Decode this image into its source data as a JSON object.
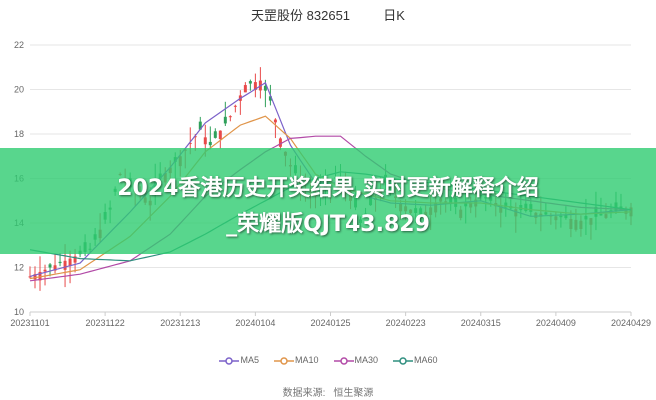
{
  "header": {
    "stock_name": "天罡股份",
    "stock_code": "832651",
    "period": "日K"
  },
  "banner": {
    "line1": "2024香港历史开奖结果,实时更新解释介绍",
    "line2": "_荣耀版QJT43.829"
  },
  "legend": [
    {
      "name": "MA5",
      "color": "#7b61c9"
    },
    {
      "name": "MA10",
      "color": "#e0954a"
    },
    {
      "name": "MA30",
      "color": "#b24aa7"
    },
    {
      "name": "MA60",
      "color": "#2f8f7f"
    }
  ],
  "source": {
    "label": "数据来源:",
    "value": "恒生聚源"
  },
  "colors": {
    "up": "#e84a4a",
    "down": "#2fa05a",
    "grid": "#e6e6e6",
    "axis_text": "#666666"
  },
  "chart_data": {
    "type": "candlestick",
    "y_ticks": [
      "10",
      "12",
      "14",
      "16",
      "18",
      "20",
      "22"
    ],
    "ylim": [
      10,
      22
    ],
    "x_ticks": [
      "20231101",
      "20231122",
      "20231213",
      "20240104",
      "20240125",
      "20240223",
      "20240315",
      "20240409",
      "20240429"
    ],
    "x_tick_positions": [
      0,
      15,
      30,
      45,
      60,
      75,
      90,
      105,
      120
    ],
    "x_count": 121,
    "ma_anchor": {
      "MA5": [
        [
          0,
          11.6
        ],
        [
          10,
          12.2
        ],
        [
          20,
          14.5
        ],
        [
          28,
          16.5
        ],
        [
          35,
          18.5
        ],
        [
          42,
          19.6
        ],
        [
          47,
          20.3
        ],
        [
          52,
          17.5
        ],
        [
          57,
          15.8
        ],
        [
          62,
          15.8
        ],
        [
          67,
          15.2
        ],
        [
          72,
          14.9
        ],
        [
          80,
          14.8
        ],
        [
          90,
          15.0
        ],
        [
          100,
          14.3
        ],
        [
          110,
          14.4
        ],
        [
          120,
          14.6
        ]
      ],
      "MA10": [
        [
          0,
          11.5
        ],
        [
          10,
          11.9
        ],
        [
          20,
          13.4
        ],
        [
          28,
          15.2
        ],
        [
          35,
          17.2
        ],
        [
          42,
          18.4
        ],
        [
          47,
          18.8
        ],
        [
          52,
          17.8
        ],
        [
          57,
          16.2
        ],
        [
          62,
          15.6
        ],
        [
          67,
          15.3
        ],
        [
          72,
          15.0
        ],
        [
          80,
          14.9
        ],
        [
          90,
          14.9
        ],
        [
          100,
          14.6
        ],
        [
          110,
          14.4
        ],
        [
          120,
          14.5
        ]
      ],
      "MA30": [
        [
          0,
          11.4
        ],
        [
          10,
          11.7
        ],
        [
          20,
          12.3
        ],
        [
          28,
          13.5
        ],
        [
          35,
          15.2
        ],
        [
          42,
          16.4
        ],
        [
          47,
          17.2
        ],
        [
          52,
          17.8
        ],
        [
          57,
          17.9
        ],
        [
          62,
          17.9
        ],
        [
          67,
          17.0
        ],
        [
          72,
          16.2
        ],
        [
          80,
          15.6
        ],
        [
          90,
          15.3
        ],
        [
          100,
          15.0
        ],
        [
          110,
          14.7
        ],
        [
          120,
          14.6
        ]
      ],
      "MA60": [
        [
          0,
          12.8
        ],
        [
          10,
          12.4
        ],
        [
          20,
          12.3
        ],
        [
          28,
          12.7
        ],
        [
          35,
          13.5
        ],
        [
          42,
          14.4
        ],
        [
          47,
          15.0
        ],
        [
          52,
          15.6
        ],
        [
          57,
          16.0
        ],
        [
          62,
          16.3
        ],
        [
          67,
          16.2
        ],
        [
          72,
          16.0
        ],
        [
          80,
          15.8
        ],
        [
          90,
          15.5
        ],
        [
          100,
          15.2
        ],
        [
          110,
          14.9
        ],
        [
          120,
          14.6
        ]
      ]
    },
    "close_anchor": [
      [
        0,
        11.6
      ],
      [
        8,
        12.4
      ],
      [
        12,
        12.8
      ],
      [
        16,
        14.6
      ],
      [
        18,
        16.2
      ],
      [
        20,
        15.6
      ],
      [
        24,
        15.0
      ],
      [
        26,
        16.0
      ],
      [
        30,
        17.0
      ],
      [
        34,
        18.2
      ],
      [
        36,
        17.5
      ],
      [
        40,
        18.8
      ],
      [
        43,
        20.2
      ],
      [
        46,
        20.4
      ],
      [
        48,
        19.5
      ],
      [
        50,
        17.8
      ],
      [
        52,
        16.6
      ],
      [
        55,
        15.5
      ],
      [
        58,
        15.2
      ],
      [
        61,
        16.0
      ],
      [
        64,
        15.4
      ],
      [
        66,
        14.0
      ],
      [
        68,
        14.8
      ],
      [
        71,
        15.8
      ],
      [
        74,
        14.9
      ],
      [
        78,
        14.3
      ],
      [
        82,
        15.1
      ],
      [
        86,
        14.6
      ],
      [
        90,
        15.2
      ],
      [
        95,
        14.7
      ],
      [
        100,
        14.5
      ],
      [
        105,
        14.3
      ],
      [
        110,
        14.1
      ],
      [
        115,
        14.4
      ],
      [
        120,
        14.7
      ]
    ]
  }
}
